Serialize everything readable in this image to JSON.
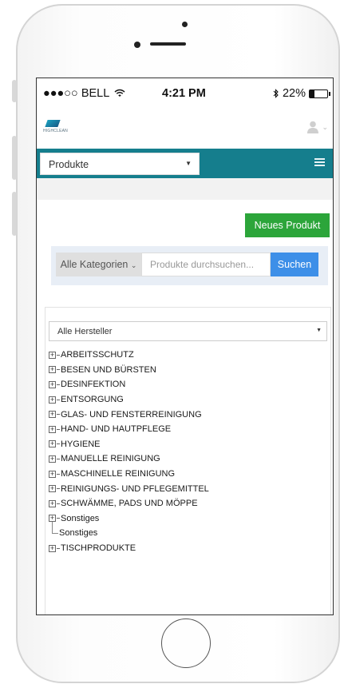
{
  "status_bar": {
    "carrier": "●●●○○ BELL",
    "wifi_icon": "wifi-icon",
    "time": "4:21 PM",
    "bluetooth_icon": "bluetooth-icon",
    "battery": "22%"
  },
  "header": {
    "logo_text": "HIGHCLEAN",
    "user_icon": "user-icon"
  },
  "nav": {
    "selected": "Produkte",
    "menu_icon": "hamburger-icon"
  },
  "actions": {
    "new_product": "Neues Produkt"
  },
  "search": {
    "category": "Alle Kategorien",
    "placeholder": "Produkte durchsuchen...",
    "button": "Suchen"
  },
  "filter": {
    "manufacturer": "Alle Hersteller"
  },
  "tree": [
    {
      "label": "ARBEITSSCHUTZ"
    },
    {
      "label": "BESEN UND BÜRSTEN"
    },
    {
      "label": "DESINFEKTION"
    },
    {
      "label": "ENTSORGUNG"
    },
    {
      "label": "GLAS- UND FENSTERREINIGUNG"
    },
    {
      "label": "HAND- UND HAUTPFLEGE"
    },
    {
      "label": "HYGIENE"
    },
    {
      "label": "MANUELLE REINIGUNG"
    },
    {
      "label": "MASCHINELLE REINIGUNG"
    },
    {
      "label": "REINIGUNGS- UND PFLEGEMITTEL"
    },
    {
      "label": "SCHWÄMME, PADS UND MÖPPE"
    },
    {
      "label": "Sonstiges"
    },
    {
      "label": "Sonstiges"
    },
    {
      "label": "TISCHPRODUKTE"
    }
  ],
  "colors": {
    "nav": "#157e8d",
    "new_button": "#2ca53a",
    "search_button": "#3d8fe8"
  }
}
